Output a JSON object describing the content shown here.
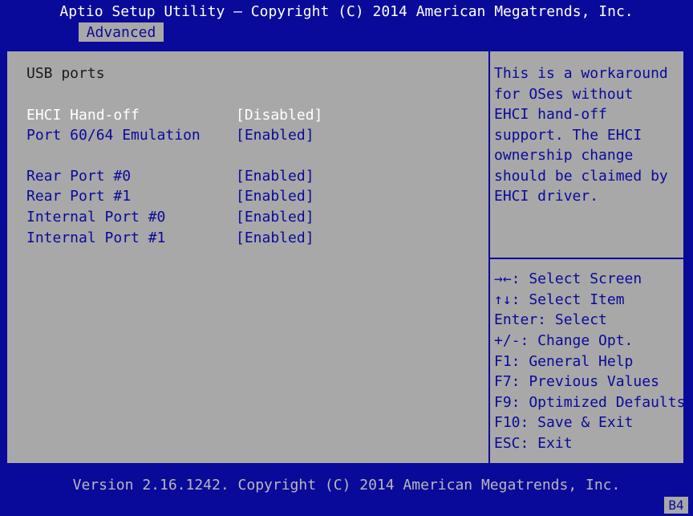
{
  "header": {
    "title": "Aptio Setup Utility – Copyright (C) 2014 American Megatrends, Inc.",
    "tab": "Advanced"
  },
  "main": {
    "heading": "USB ports",
    "settings": [
      {
        "label": "EHCI Hand-off",
        "value": "[Disabled]"
      },
      {
        "label": "Port 60/64 Emulation",
        "value": "[Enabled]"
      },
      {
        "label": "Rear Port #0",
        "value": "[Enabled]"
      },
      {
        "label": "Rear Port #1",
        "value": "[Enabled]"
      },
      {
        "label": "Internal Port #0",
        "value": "[Enabled]"
      },
      {
        "label": "Internal Port #1",
        "value": "[Enabled]"
      }
    ]
  },
  "help": {
    "description": [
      "This is a workaround",
      "for OSes without",
      "EHCI hand-off",
      "support. The EHCI",
      "ownership change",
      "should be claimed by",
      "EHCI driver."
    ],
    "keys": [
      "→←: Select Screen",
      "↑↓: Select Item",
      "Enter: Select",
      "+/-: Change Opt.",
      "F1: General Help",
      "F7: Previous Values",
      "F9: Optimized Defaults",
      "F10: Save & Exit",
      "ESC: Exit"
    ]
  },
  "footer": {
    "version": "Version 2.16.1242. Copyright (C) 2014 American Megatrends, Inc.",
    "badge": "B4"
  }
}
